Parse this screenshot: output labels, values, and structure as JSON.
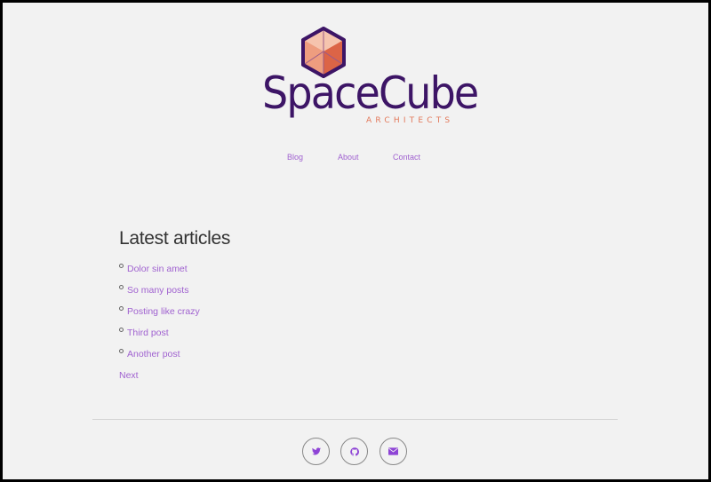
{
  "brand": {
    "name": "SpaceCube",
    "tagline": "ARCHITECTS",
    "colors": {
      "primary": "#3d1566",
      "accent": "#e2785a",
      "link": "#a062d0"
    }
  },
  "nav": {
    "items": [
      {
        "label": "Blog"
      },
      {
        "label": "About"
      },
      {
        "label": "Contact"
      }
    ]
  },
  "main": {
    "heading": "Latest articles",
    "articles": [
      {
        "title": "Dolor sin amet"
      },
      {
        "title": "So many posts"
      },
      {
        "title": "Posting like crazy"
      },
      {
        "title": "Third post"
      },
      {
        "title": "Another post"
      }
    ],
    "pagination": {
      "next_label": "Next"
    }
  },
  "footer": {
    "social": [
      {
        "icon": "twitter-icon"
      },
      {
        "icon": "github-icon"
      },
      {
        "icon": "email-icon"
      }
    ]
  }
}
